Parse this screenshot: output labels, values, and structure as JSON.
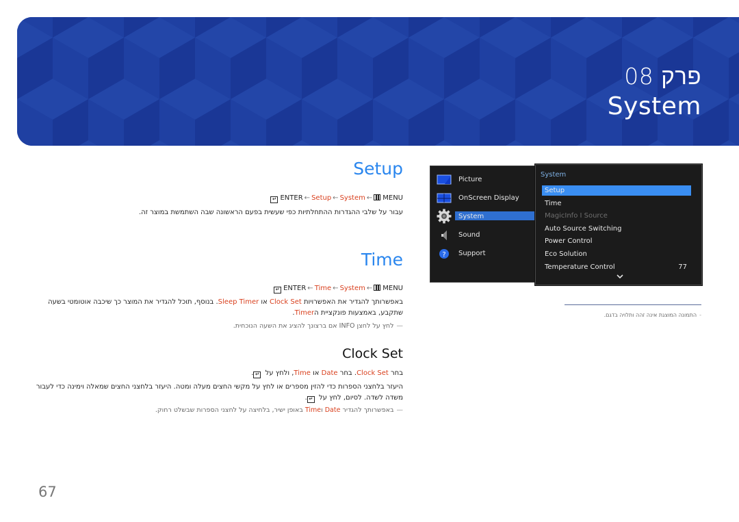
{
  "banner": {
    "chapter_label": "פרק 08",
    "chapter_title": "System"
  },
  "sections": {
    "setup": {
      "heading": "Setup",
      "path": {
        "menu": "MENU",
        "system": "System",
        "item": "Setup",
        "enter": "ENTER"
      },
      "description": "עבור על שלבי ההגדרות ההתחלתיות כפי שעשית בפעם הראשונה שבה השתמשת במוצר זה."
    },
    "time": {
      "heading": "Time",
      "path": {
        "menu": "MENU",
        "system": "System",
        "item": "Time",
        "enter": "ENTER"
      },
      "desc_part1": "באפשרותך להגדיר את האפשרויות ",
      "clock_set": "Clock Set",
      "desc_or": " או ",
      "sleep_timer": "Sleep Timer",
      "desc_part2": ". בנוסף, תוכל להגדיר את המוצר כך שיכבה אוטומטי בשעה שתקבע, באמצעות פונקציית ה",
      "timer": "Timer",
      "desc_end": ".",
      "note": "לחץ על לחצן INFO אם ברצונך להציג את השעה הנוכחית."
    },
    "clock_set": {
      "heading": "Clock Set",
      "line1_a": "בחר ",
      "line1_clock_set": "Clock Set",
      "line1_b": ". בחר ",
      "line1_date": "Date",
      "line1_c": " או ",
      "line1_time": "Time",
      "line1_d": ", ולחץ על ",
      "line1_end": ".",
      "line2": "היעזר בלחצני הספרות כדי להזין מספרים או לחץ על מקשי החצים מעלה ומטה. היעזר בלחצני החצים שמאלה וימינה כדי לעבור משדה לשדה. לסיום, לחץ על ",
      "line2_end": ".",
      "note_a": "באפשרותך להגדיר ",
      "note_date": "Date",
      "note_and": " ו",
      "note_time": "Time",
      "note_b": " באופן ישיר, בלחיצה על לחצני הספרות שבשלט רחוק."
    }
  },
  "osd": {
    "main_menu": [
      {
        "label": "Picture",
        "icon": "picture-icon"
      },
      {
        "label": "OnScreen Display",
        "icon": "onscreen-display-icon"
      },
      {
        "label": "System",
        "icon": "gear-icon",
        "active": true
      },
      {
        "label": "Sound",
        "icon": "speaker-icon"
      },
      {
        "label": "Support",
        "icon": "question-icon"
      }
    ],
    "submenu_title": "System",
    "submenu": [
      {
        "label": "Setup",
        "active": true
      },
      {
        "label": "Time"
      },
      {
        "label": "MagicInfo I Source",
        "disabled": true
      },
      {
        "label": "Auto Source Switching"
      },
      {
        "label": "Power Control"
      },
      {
        "label": "Eco Solution"
      },
      {
        "label": "Temperature Control",
        "value": "77"
      }
    ],
    "colors": {
      "highlight": "#3a8ef2",
      "main_highlight": "#2f6fd0",
      "title": "#7fb2e6"
    }
  },
  "caption": "התמונה המוצגת אינה זהה ותלויה בדגם.",
  "page_number": "67",
  "colors": {
    "heading_blue": "#2a86ee",
    "link_red": "#d9401e",
    "banner": "#1e3e9e"
  }
}
